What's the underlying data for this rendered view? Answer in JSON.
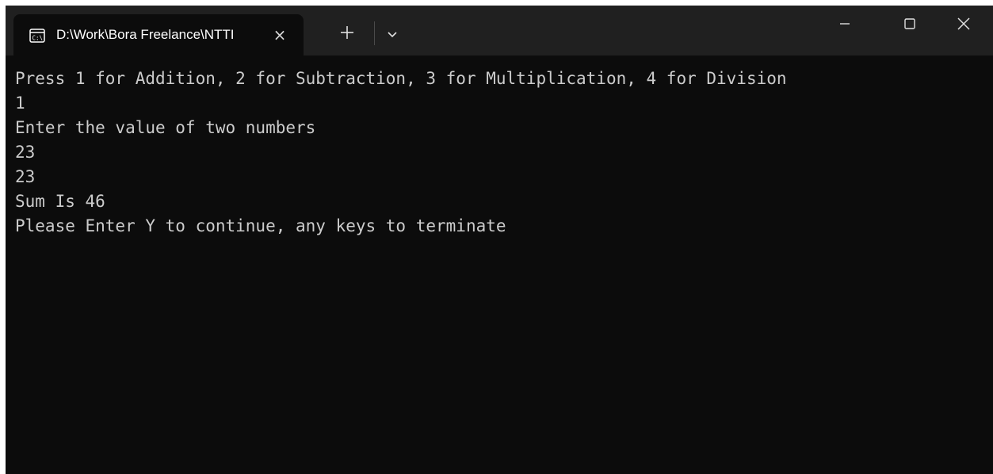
{
  "window": {
    "tab_title": "D:\\Work\\Bora Freelance\\NTTI",
    "tab_icon": "console-icon",
    "tab_close_glyph": "×",
    "icons": {
      "new_tab": "plus-icon",
      "dropdown": "chevron-down-icon",
      "minimize": "minimize-icon",
      "maximize": "maximize-icon",
      "close": "close-icon"
    }
  },
  "terminal": {
    "lines": [
      "Press 1 for Addition, 2 for Subtraction, 3 for Multiplication, 4 for Division",
      "1",
      "Enter the value of two numbers",
      "23",
      "23",
      "Sum Is 46",
      "Please Enter Y to continue, any keys to terminate"
    ]
  },
  "colors": {
    "titlebar": "#202020",
    "terminal_bg": "#0c0c0c",
    "terminal_fg": "#cccccc"
  }
}
